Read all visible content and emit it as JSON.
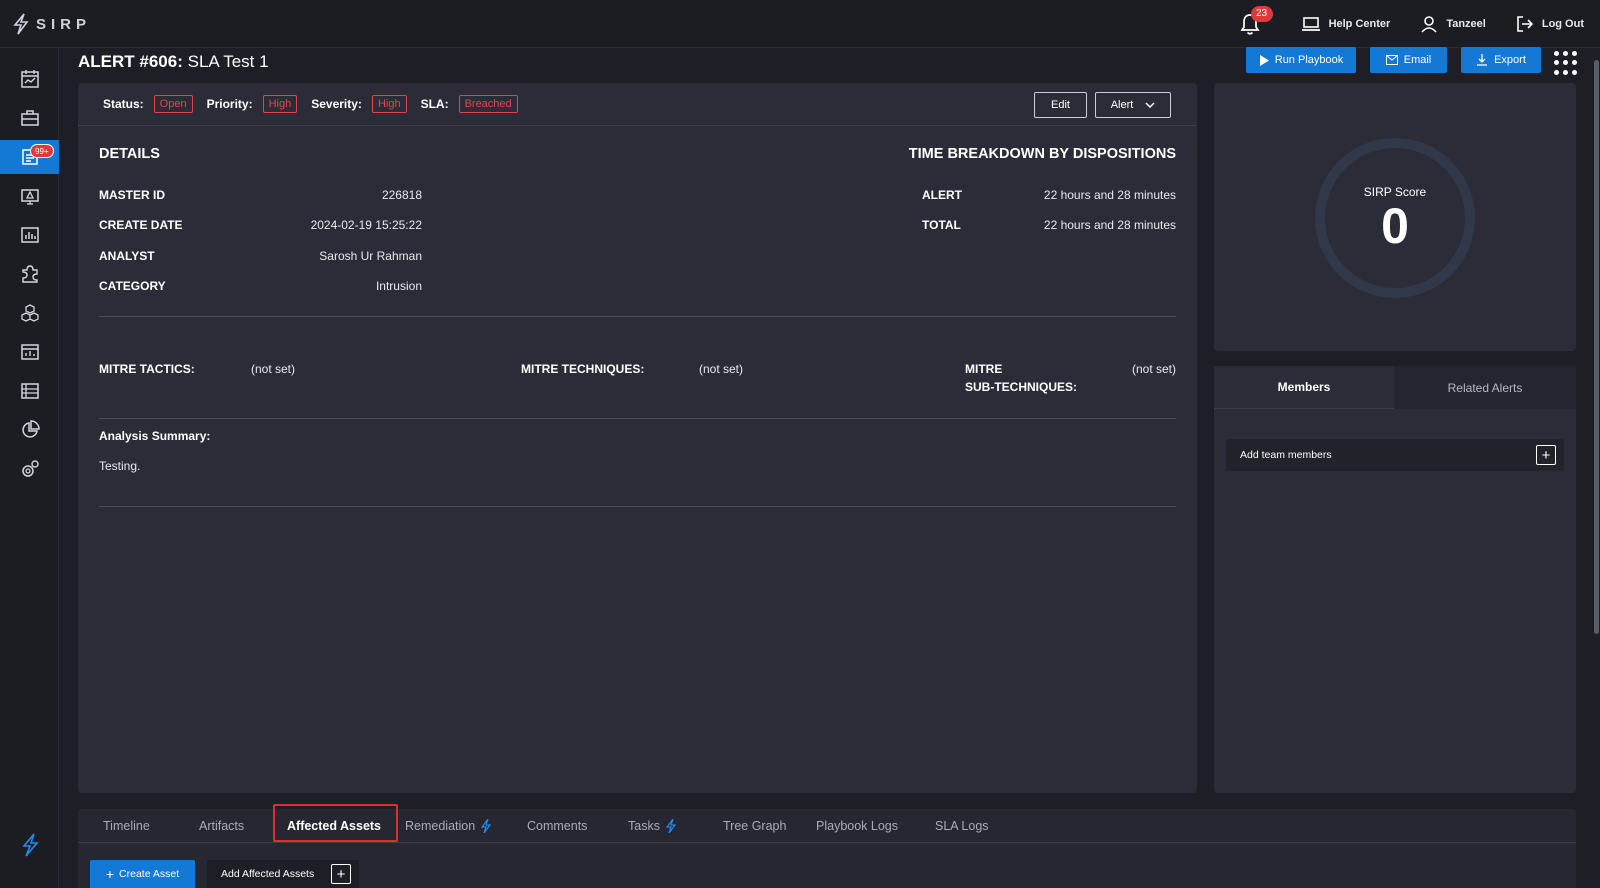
{
  "app": {
    "logo_text": "SIRP"
  },
  "topbar": {
    "notifications_count": "23",
    "help_center": "Help Center",
    "user": "Tanzeel",
    "logout": "Log Out"
  },
  "sidebar": {
    "alerts_badge": "99+",
    "items": [
      "dashboard",
      "cases",
      "alerts",
      "monitoring",
      "reports",
      "integrations",
      "assets",
      "analytics",
      "data",
      "charts",
      "settings"
    ]
  },
  "alert": {
    "number_label": "ALERT #606:",
    "name": "SLA Test 1"
  },
  "actions": {
    "run_playbook": "Run Playbook",
    "email": "Email",
    "export": "Export"
  },
  "status_bar": {
    "status_label": "Status:",
    "status_value": "Open",
    "priority_label": "Priority:",
    "priority_value": "High",
    "severity_label": "Severity:",
    "severity_value": "High",
    "sla_label": "SLA:",
    "sla_value": "Breached",
    "edit": "Edit",
    "alert_dropdown": "Alert"
  },
  "details": {
    "heading": "DETAILS",
    "master_id_label": "MASTER ID",
    "master_id": "226818",
    "create_date_label": "CREATE DATE",
    "create_date": "2024-02-19 15:25:22",
    "analyst_label": "ANALYST",
    "analyst": "Sarosh Ur Rahman",
    "category_label": "CATEGORY",
    "category": "Intrusion"
  },
  "time_breakdown": {
    "heading": "TIME BREAKDOWN BY DISPOSITIONS",
    "alert_label": "ALERT",
    "alert_value": "22 hours and 28 minutes",
    "total_label": "TOTAL",
    "total_value": "22 hours and 28 minutes"
  },
  "mitre": {
    "tactics_label": "MITRE TACTICS:",
    "tactics_value": "(not set)",
    "techniques_label": "MITRE TECHNIQUES:",
    "techniques_value": "(not set)",
    "sub_label_1": "MITRE",
    "sub_label_2": "SUB-TECHNIQUES:",
    "sub_value": "(not set)"
  },
  "analysis": {
    "label": "Analysis Summary:",
    "text": "Testing."
  },
  "score": {
    "label": "SIRP Score",
    "value": "0"
  },
  "members_panel": {
    "tab_members": "Members",
    "tab_related": "Related Alerts",
    "add_members": "Add team members"
  },
  "bottom_tabs": {
    "timeline": "Timeline",
    "artifacts": "Artifacts",
    "affected_assets": "Affected Assets",
    "remediation": "Remediation",
    "comments": "Comments",
    "tasks": "Tasks",
    "tree_graph": "Tree Graph",
    "playbook_logs": "Playbook Logs",
    "sla_logs": "SLA Logs"
  },
  "assets": {
    "create_asset": "Create Asset",
    "add_affected": "Add Affected Assets"
  },
  "colors": {
    "accent": "#1479d4",
    "danger": "#e0454a",
    "background": "#1e1f26",
    "card": "#2b2c37"
  }
}
